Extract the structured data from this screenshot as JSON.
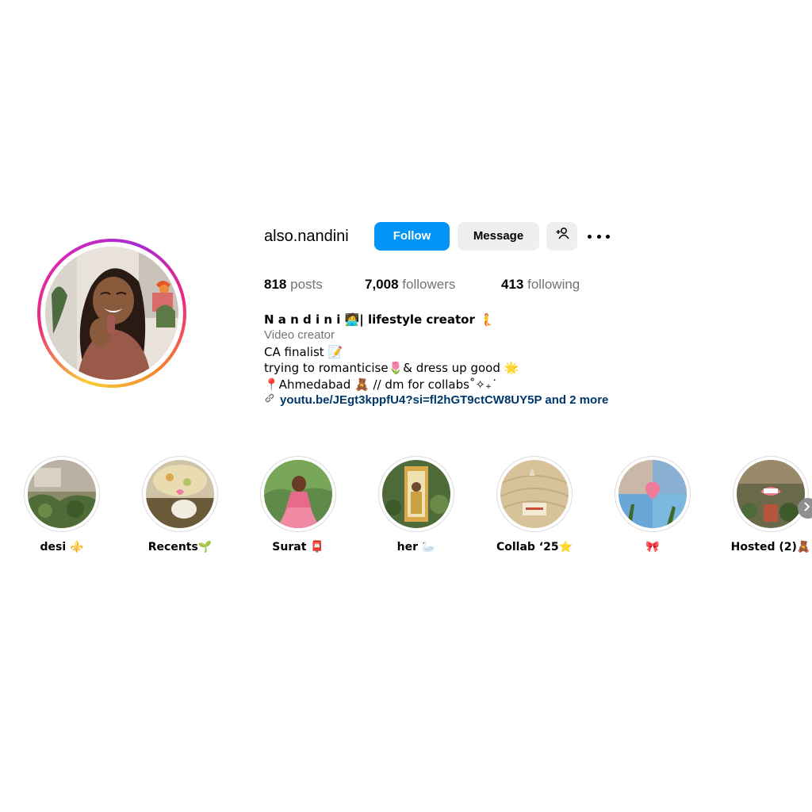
{
  "profile": {
    "username": "also.nandini",
    "follow_label": "Follow",
    "message_label": "Message",
    "suggest_icon": "person-plus-icon",
    "more_icon": "more-options-icon"
  },
  "stats": {
    "posts_count": "818",
    "posts_label": "posts",
    "followers_count": "7,008",
    "followers_label": "followers",
    "following_count": "413",
    "following_label": "following"
  },
  "bio": {
    "name_line": "N a n d i n i 🧑‍💻| lifestyle creator 🧜",
    "category": "Video creator",
    "line1": "CA finalist 📝",
    "line2": "trying to romanticise🌷& dress up good 🌟",
    "line3": "📍Ahmedabad 🧸 // dm for collabs˚✧₊˙",
    "link": "youtu.be/JEgt3kppfU4?si=fl2hGT9ctCW8UY5P and 2 more"
  },
  "highlights": [
    {
      "label": "desi ⚜️"
    },
    {
      "label": "Recents🌱"
    },
    {
      "label": "Surat 📮"
    },
    {
      "label": "her 🦢"
    },
    {
      "label": "Collab ‘25⭐"
    },
    {
      "label": "🎀"
    },
    {
      "label": "Hosted (2)🧸"
    }
  ],
  "colors": {
    "follow_button": "#0095f6",
    "secondary_button": "#efefef",
    "link_text": "#00376b",
    "muted_text": "#737373"
  }
}
